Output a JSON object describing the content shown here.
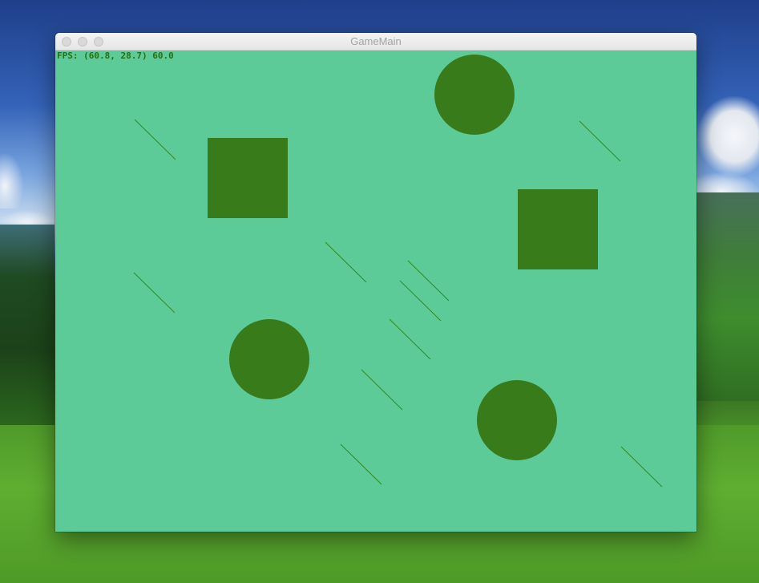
{
  "window": {
    "title": "GameMain"
  },
  "hud": {
    "fps_text": "FPS: (60.8, 28.7) 60.0"
  },
  "colors": {
    "background": "#5ccb98",
    "shape_fill": "#387b1b",
    "line_stroke": "#2f8a20",
    "hud_text": "#2a6e12"
  },
  "entities": {
    "circles": 3,
    "squares": 2,
    "lines": 10
  }
}
